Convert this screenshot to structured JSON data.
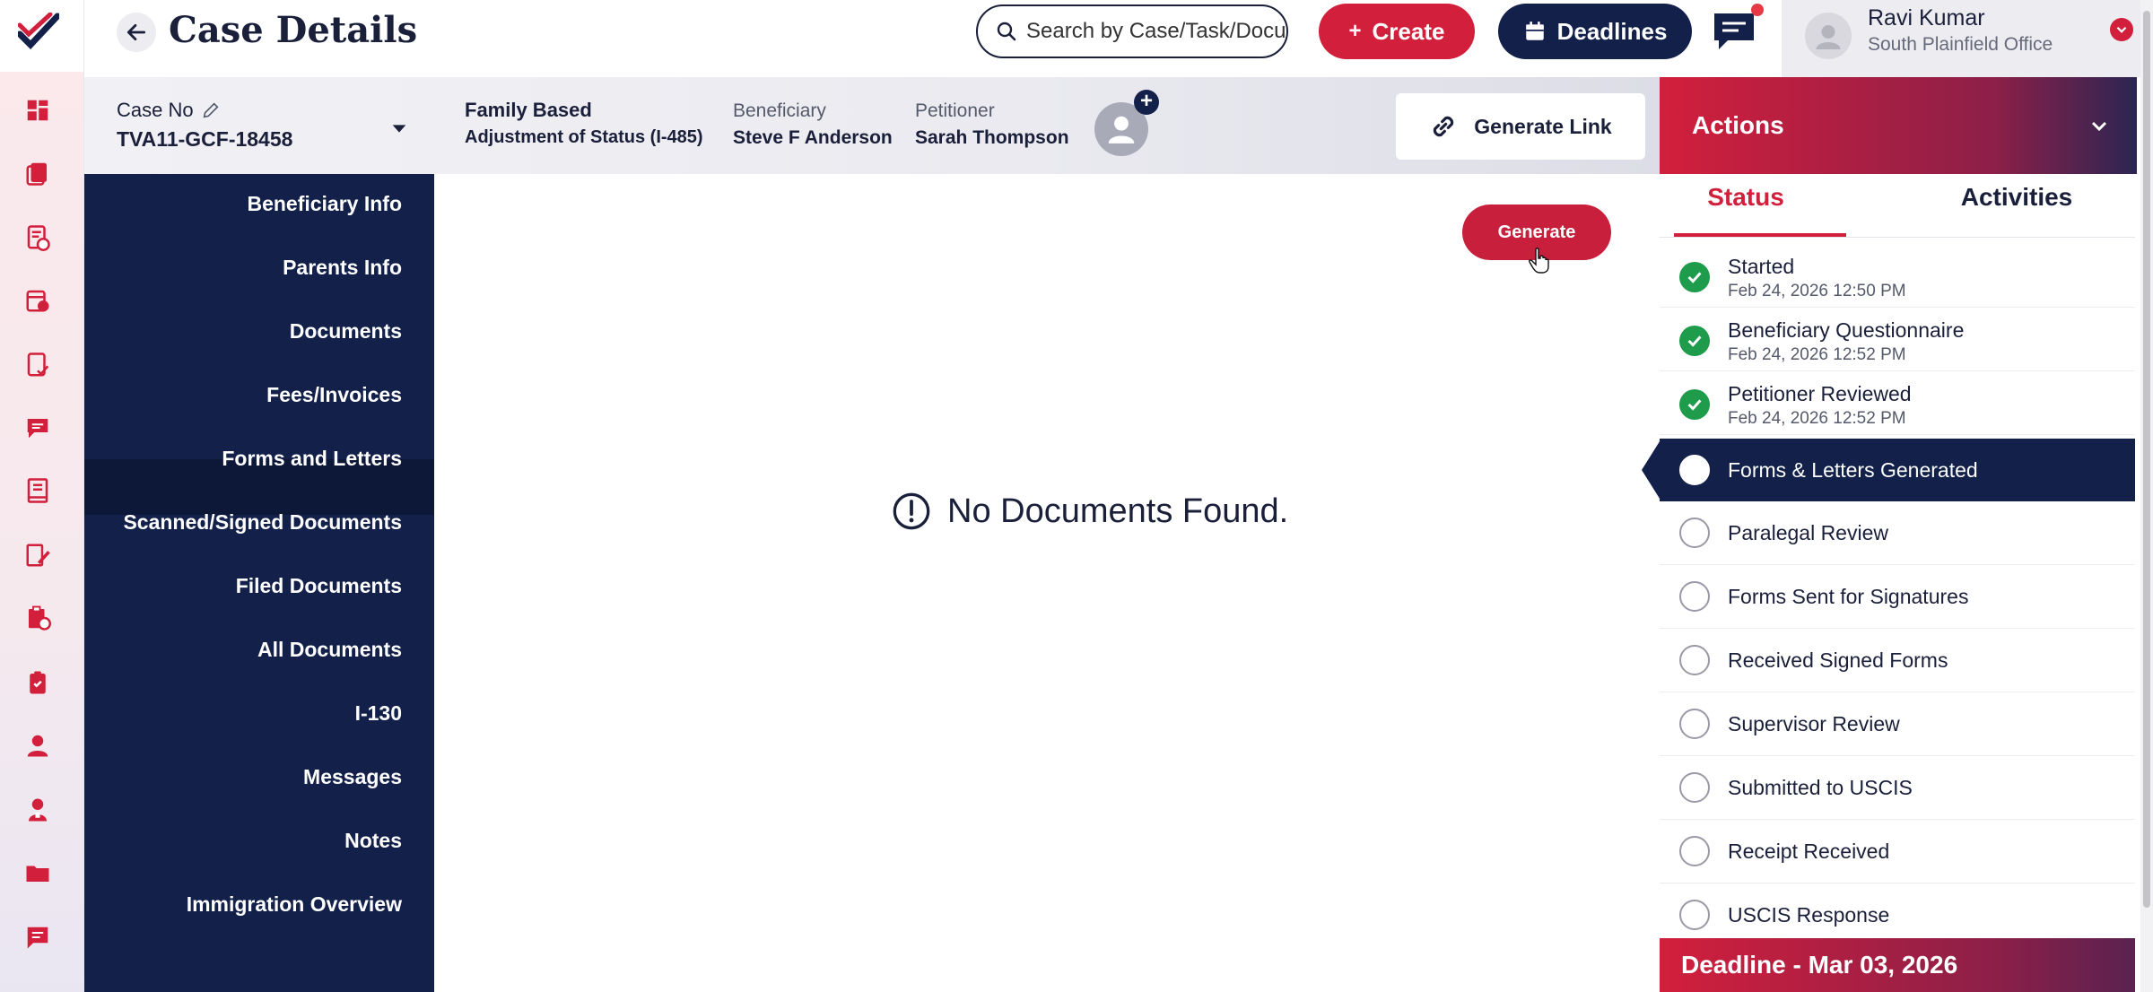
{
  "header": {
    "title": "Case Details",
    "search_placeholder": "Search by Case/Task/Docu",
    "create_label": "Create",
    "deadlines_label": "Deadlines",
    "user_name": "Ravi Kumar",
    "user_office": "South Plainfield Office"
  },
  "case": {
    "case_no_label": "Case No",
    "case_no": "TVA11-GCF-18458",
    "type": "Family Based",
    "subtype": "Adjustment of Status (I-485)",
    "beneficiary_label": "Beneficiary",
    "beneficiary": "Steve F Anderson",
    "petitioner_label": "Petitioner",
    "petitioner": "Sarah Thompson",
    "generate_link_label": "Generate Link"
  },
  "subnav": {
    "items": [
      "Beneficiary Info",
      "Parents Info",
      "Documents",
      "Fees/Invoices",
      "Forms and Letters",
      "Scanned/Signed Documents",
      "Filed Documents",
      "All Documents",
      "I-130",
      "Messages",
      "Notes",
      "Immigration Overview"
    ],
    "active": "Forms and Letters"
  },
  "main": {
    "generate_label": "Generate",
    "empty_message": "No Documents Found."
  },
  "actions": {
    "title": "Actions",
    "tabs": [
      "Status",
      "Activities"
    ],
    "active_tab": "Status",
    "statuses": [
      {
        "label": "Started",
        "timestamp": "Feb 24, 2026 12:50 PM",
        "done": true
      },
      {
        "label": "Beneficiary Questionnaire",
        "timestamp": "Feb 24, 2026 12:52 PM",
        "done": true
      },
      {
        "label": "Petitioner Reviewed",
        "timestamp": "Feb 24, 2026 12:52 PM",
        "done": true
      },
      {
        "label": "Forms & Letters Generated",
        "done": false,
        "active": true
      },
      {
        "label": "Paralegal Review",
        "done": false
      },
      {
        "label": "Forms Sent for Signatures",
        "done": false
      },
      {
        "label": "Received Signed Forms",
        "done": false
      },
      {
        "label": "Supervisor Review",
        "done": false
      },
      {
        "label": "Submitted to USCIS",
        "done": false
      },
      {
        "label": "Receipt Received",
        "done": false
      },
      {
        "label": "USCIS Response",
        "done": false
      }
    ],
    "deadline": "Deadline - Mar 03, 2026"
  },
  "rail_icons": [
    "dashboard-icon",
    "cases-icon",
    "tasks-icon",
    "calendar-doc-icon",
    "checklist-icon",
    "messages-icon",
    "ledger-icon",
    "edit-doc-icon",
    "reports-icon",
    "clipboard-icon",
    "user-icon",
    "contacts-icon",
    "folder-icon",
    "notes-icon"
  ],
  "colors": {
    "navy": "#12204a",
    "accent_red": "#d21f3c",
    "success_green": "#1e9b4b"
  }
}
